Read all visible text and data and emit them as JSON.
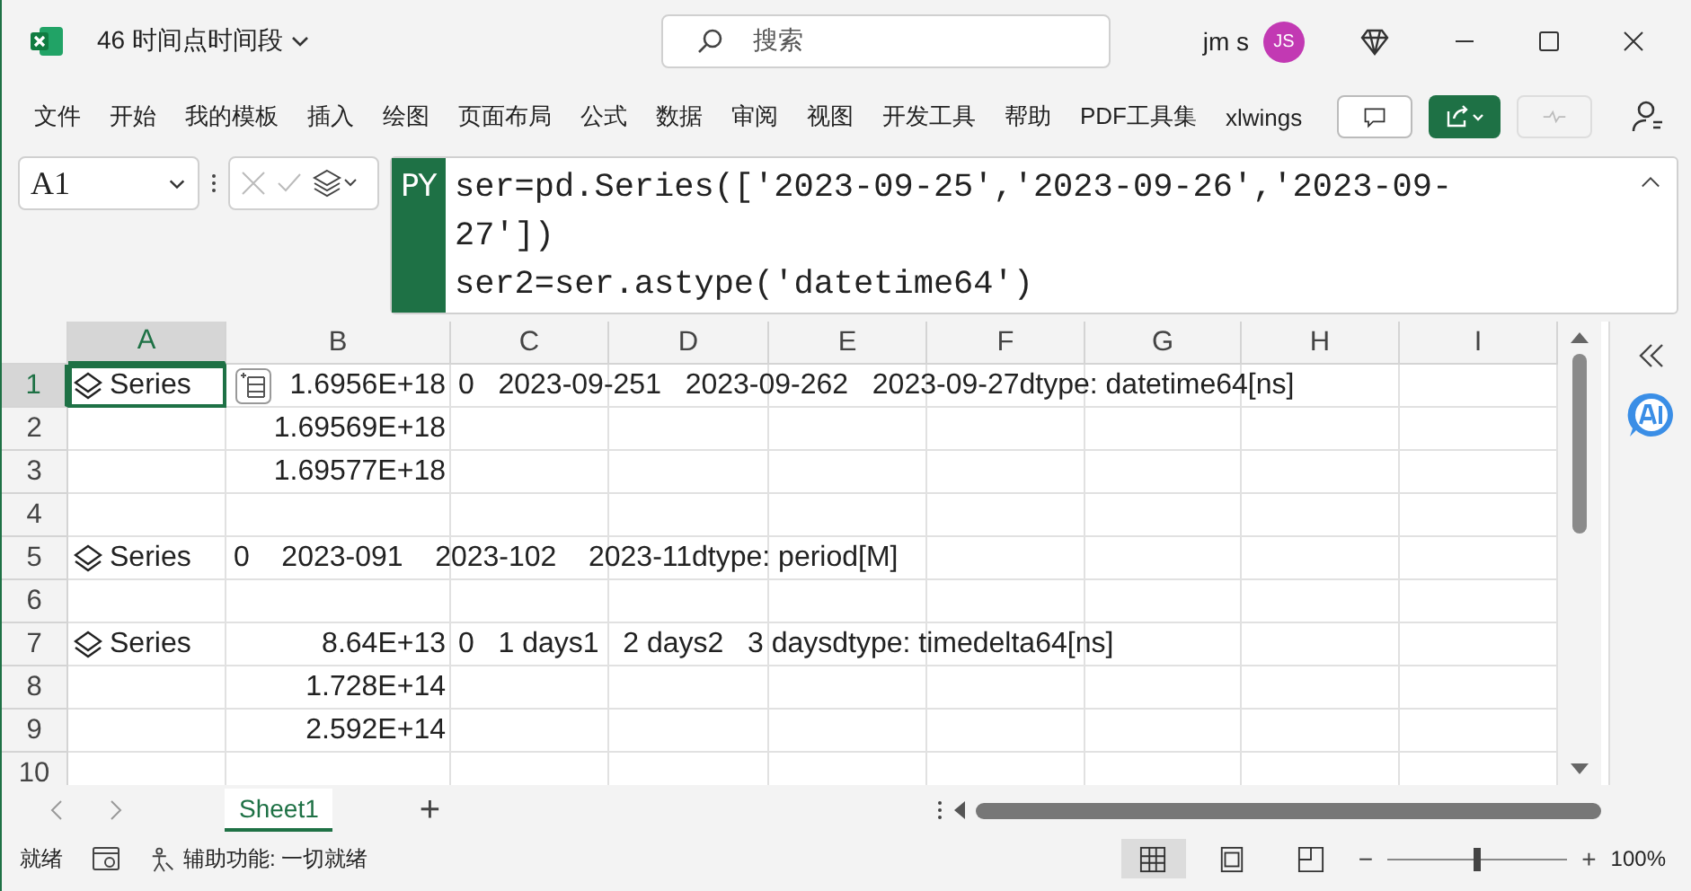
{
  "window": {
    "title": "46 时间点时间段",
    "search_placeholder": "搜索",
    "user_name": "jm s",
    "avatar_initials": "JS"
  },
  "menu": [
    {
      "label": "文件"
    },
    {
      "label": "开始"
    },
    {
      "label": "我的模板"
    },
    {
      "label": "插入"
    },
    {
      "label": "绘图"
    },
    {
      "label": "页面布局"
    },
    {
      "label": "公式"
    },
    {
      "label": "数据"
    },
    {
      "label": "审阅"
    },
    {
      "label": "视图"
    },
    {
      "label": "开发工具"
    },
    {
      "label": "帮助"
    },
    {
      "label": "PDF工具集"
    },
    {
      "label": "xlwings"
    }
  ],
  "formula_bar": {
    "name_box": "A1",
    "badge": "PY",
    "lines": [
      "ser=pd.Series(['2023-09-25','2023-09-26','2023-09-",
      "27'])",
      "ser2=ser.astype('datetime64')"
    ]
  },
  "columns": [
    {
      "label": "A",
      "selected": true
    },
    {
      "label": "B",
      "selected": false
    },
    {
      "label": "C",
      "selected": false
    },
    {
      "label": "D",
      "selected": false
    },
    {
      "label": "E",
      "selected": false
    },
    {
      "label": "F",
      "selected": false
    },
    {
      "label": "G",
      "selected": false
    },
    {
      "label": "H",
      "selected": false
    },
    {
      "label": "I",
      "selected": false
    }
  ],
  "rows": [
    {
      "number": "1",
      "selected": true,
      "cells": [
        {
          "kind": "series",
          "text": "Series",
          "selected": true
        },
        {
          "kind": "number",
          "text": "1.6956E+18",
          "selected": false
        },
        {
          "kind": "text",
          "text": "0   2023-09-251   2023-09-262   2023-09-27dtype: datetime64[ns]",
          "selected": false
        }
      ]
    },
    {
      "number": "2",
      "selected": false,
      "cells": [
        null,
        {
          "kind": "number",
          "text": "1.69569E+18",
          "selected": false
        }
      ]
    },
    {
      "number": "3",
      "selected": false,
      "cells": [
        null,
        {
          "kind": "number",
          "text": "1.69577E+18",
          "selected": false
        }
      ]
    },
    {
      "number": "4",
      "selected": false,
      "cells": []
    },
    {
      "number": "5",
      "selected": false,
      "cells": [
        {
          "kind": "series",
          "text": "Series",
          "selected": false
        },
        {
          "kind": "text",
          "text": "0    2023-091    2023-102    2023-11dtype: period[M]",
          "selected": false
        }
      ]
    },
    {
      "number": "6",
      "selected": false,
      "cells": []
    },
    {
      "number": "7",
      "selected": false,
      "cells": [
        {
          "kind": "series",
          "text": "Series",
          "selected": false
        },
        {
          "kind": "number",
          "text": "8.64E+13",
          "selected": false
        },
        {
          "kind": "text",
          "text": "0   1 days1   2 days2   3 daysdtype: timedelta64[ns]",
          "selected": false
        }
      ]
    },
    {
      "number": "8",
      "selected": false,
      "cells": [
        null,
        {
          "kind": "number",
          "text": "1.728E+14",
          "selected": false
        }
      ]
    },
    {
      "number": "9",
      "selected": false,
      "cells": [
        null,
        {
          "kind": "number",
          "text": "2.592E+14",
          "selected": false
        }
      ]
    },
    {
      "number": "10",
      "selected": false,
      "cells": []
    }
  ],
  "sheet_tabs": [
    {
      "label": "Sheet1",
      "selected": true
    }
  ],
  "add_sheet": "+",
  "status_bar": {
    "status": "就绪",
    "accessibility": "辅助功能: 一切就绪",
    "views": [
      {
        "kind": "normal",
        "selected": true
      },
      {
        "kind": "layout",
        "selected": false
      },
      {
        "kind": "pagebreak",
        "selected": false
      }
    ],
    "zoom_minus": "−",
    "zoom_plus": "+",
    "zoom": {
      "level": 0.5
    },
    "zoom_text": "100%"
  }
}
